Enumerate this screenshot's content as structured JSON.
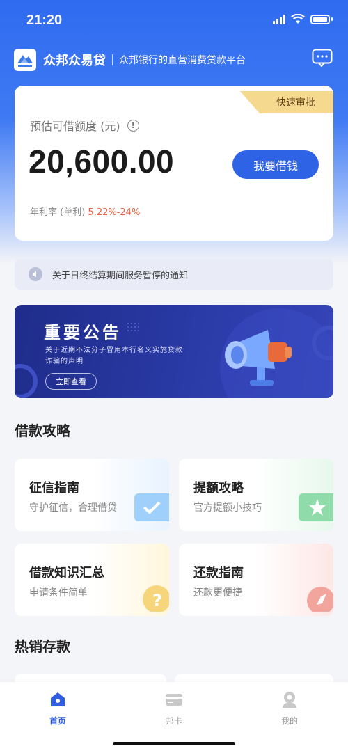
{
  "status_bar": {
    "time": "21:20"
  },
  "header": {
    "app_name": "众邦众易贷",
    "slogan": "众邦银行的直营消费贷款平台",
    "icons": [
      "logo-icon",
      "message-icon"
    ]
  },
  "credit_card": {
    "badge": "快速审批",
    "limit_label": "预估可借额度 (元)",
    "info_glyph": "!",
    "amount": "20,600.00",
    "borrow_button": "我要借钱",
    "rate_label": "年利率 (单利)",
    "rate_value": "5.22%-24%"
  },
  "notice": {
    "text": "关于日终结算期间服务暂停的通知",
    "icon": "speaker-icon"
  },
  "banner": {
    "title": "重要公告",
    "subtitle": "关于近期不法分子冒用本行名义实施贷款诈骗的声明",
    "button": "立即查看",
    "icon": "megaphone-icon"
  },
  "guides": {
    "section_title": "借款攻略",
    "items": [
      {
        "title": "征信指南",
        "subtitle": "守护征信，合理借贷",
        "icon": "check-icon",
        "color": "#5aa8f0"
      },
      {
        "title": "提额攻略",
        "subtitle": "官方提额小技巧",
        "icon": "star-icon",
        "color": "#4cc67a"
      },
      {
        "title": "借款知识汇总",
        "subtitle": "申请条件简单",
        "icon": "question-icon",
        "color": "#f2c44c"
      },
      {
        "title": "还款指南",
        "subtitle": "还款更便捷",
        "icon": "compass-icon",
        "color": "#ee7a6e"
      }
    ]
  },
  "deposits": {
    "section_title": "热销存款"
  },
  "tabbar": {
    "items": [
      {
        "label": "首页",
        "icon": "home-icon",
        "active": true
      },
      {
        "label": "邦卡",
        "icon": "card-icon",
        "active": false
      },
      {
        "label": "我的",
        "icon": "user-icon",
        "active": false
      }
    ]
  },
  "colors": {
    "primary": "#2f63e6",
    "rate": "#e8603a",
    "badge": "#f5d98e"
  }
}
